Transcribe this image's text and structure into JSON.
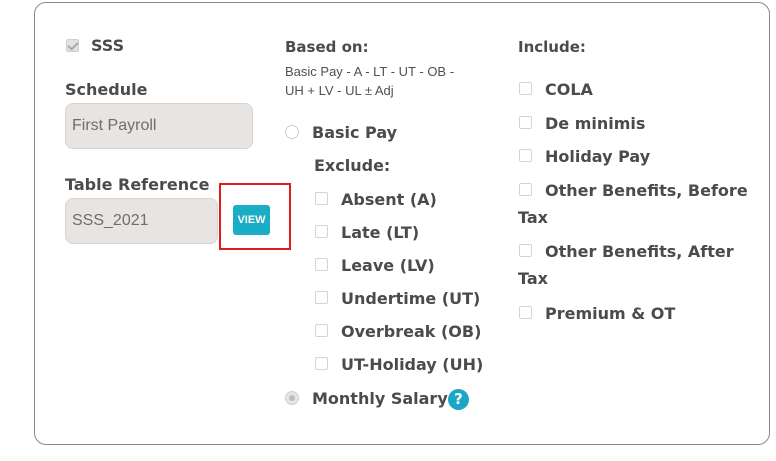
{
  "sss": {
    "label": "SSS",
    "checked": true
  },
  "schedule": {
    "label": "Schedule",
    "value": "First Payroll"
  },
  "table_reference": {
    "label": "Table Reference",
    "value": "SSS_2021",
    "view_label": "VIEW"
  },
  "based_on": {
    "title": "Based on:",
    "formula_line1": "Basic Pay - A - LT - UT - OB -",
    "formula_line2": "UH + LV - UL ± Adj",
    "basic_pay_label": "Basic Pay",
    "exclude_title": "Exclude:",
    "exclude_items": [
      "Absent (A)",
      "Late (LT)",
      "Leave (LV)",
      "Undertime (UT)",
      "Overbreak (OB)",
      "UT-Holiday (UH)"
    ],
    "monthly_salary_label": "Monthly Salary",
    "help_glyph": "?"
  },
  "include": {
    "title": "Include:",
    "items": {
      "cola": "COLA",
      "de_minimis": "De minimis",
      "holiday_pay": "Holiday Pay",
      "other_before_line1": "Other Benefits, Before",
      "other_before_line2": "Tax",
      "other_after_line1": "Other Benefits, After",
      "other_after_line2": "Tax",
      "premium_ot": "Premium & OT"
    }
  },
  "colors": {
    "accent": "#1aaec6",
    "highlight": "#e01c1c"
  },
  "icons": {
    "help": "question-circle-icon"
  }
}
